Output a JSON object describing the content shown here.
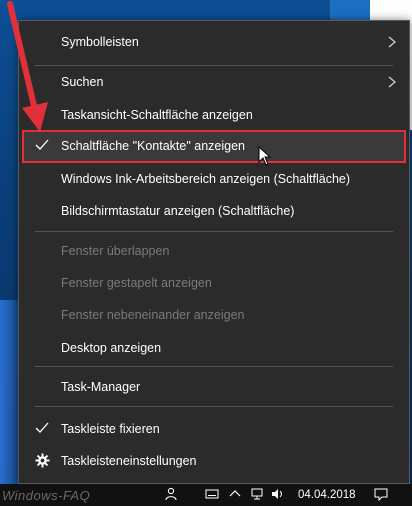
{
  "menu": {
    "items": [
      {
        "label": "Symbolleisten",
        "submenu": true
      },
      {
        "label": "Suchen",
        "submenu": true
      },
      {
        "label": "Taskansicht-Schaltfläche anzeigen"
      },
      {
        "label": "Schaltfläche \"Kontakte\" anzeigen",
        "checked": true,
        "highlighted": true
      },
      {
        "label": "Windows Ink-Arbeitsbereich anzeigen (Schaltfläche)"
      },
      {
        "label": "Bildschirmtastatur anzeigen (Schaltfläche)"
      },
      {
        "label": "Fenster überlappen",
        "disabled": true
      },
      {
        "label": "Fenster gestapelt anzeigen",
        "disabled": true
      },
      {
        "label": "Fenster nebeneinander anzeigen",
        "disabled": true
      },
      {
        "label": "Desktop anzeigen"
      },
      {
        "label": "Task-Manager"
      },
      {
        "label": "Taskleiste fixieren",
        "checked": true
      },
      {
        "label": "Taskleisteneinstellungen",
        "icon": "gear-icon"
      }
    ]
  },
  "taskbar": {
    "date": "04.04.2018",
    "watermark": "Windows-FAQ"
  },
  "colors": {
    "menu_bg": "#2b2b2b",
    "highlight_border": "#e2303a",
    "arrow": "#e2303a",
    "disabled_text": "#7a7a7a"
  }
}
